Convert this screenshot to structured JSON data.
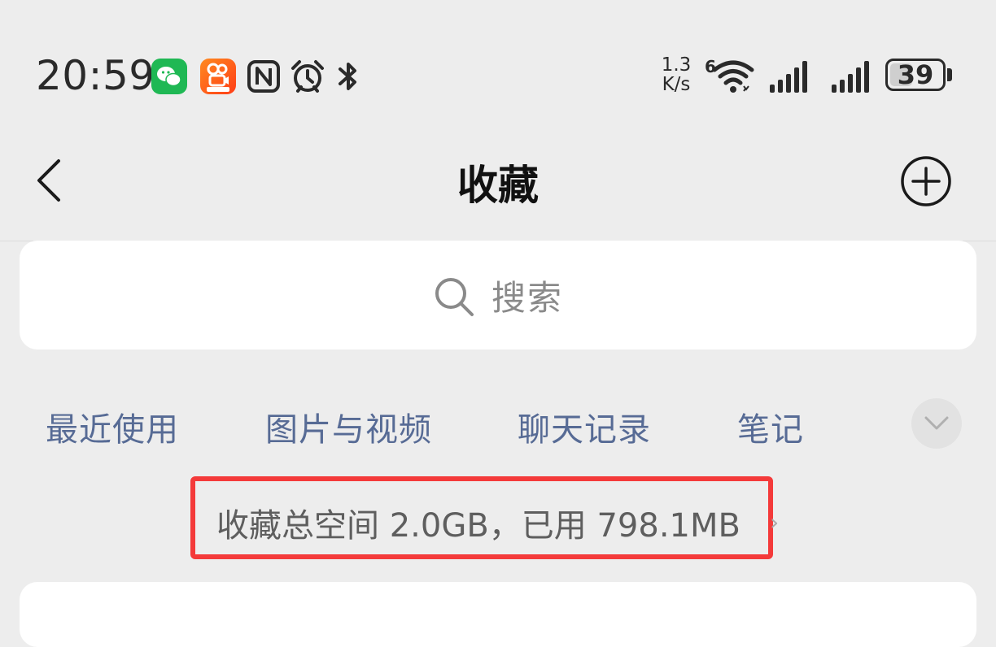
{
  "status_bar": {
    "time": "20:59",
    "net_speed_value": "1.3",
    "net_speed_unit": "K/s",
    "wifi_badge": "6",
    "battery_level": "39",
    "icons": [
      "wechat-app-icon",
      "kuaishou-app-icon",
      "nfc-icon",
      "alarm-icon",
      "bluetooth-icon",
      "wifi-icon",
      "signal-icon",
      "signal-icon-2",
      "battery-icon"
    ]
  },
  "nav": {
    "title": "收藏",
    "back_icon": "chevron-left-icon",
    "add_icon": "plus-circle-icon"
  },
  "search": {
    "placeholder": "搜索"
  },
  "tabs": {
    "items": [
      {
        "label": "最近使用"
      },
      {
        "label": "图片与视频"
      },
      {
        "label": "聊天记录"
      },
      {
        "label": "笔记"
      }
    ],
    "expand_icon": "chevron-down-icon"
  },
  "storage": {
    "text": "收藏总空间 2.0GB，已用 798.1MB",
    "chevron": "›"
  },
  "colors": {
    "background": "#ededed",
    "tab_text": "#576b95",
    "highlight_border": "#f43a3a",
    "card": "#ffffff"
  }
}
